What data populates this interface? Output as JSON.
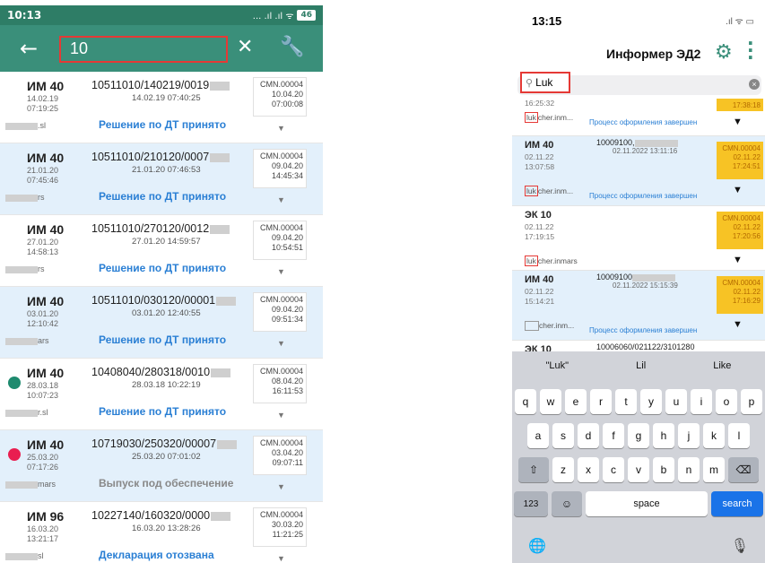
{
  "android": {
    "time": "10:13",
    "signal": "... .ıl .ıl ᯤ",
    "battery": "46",
    "back_icon": "arrow-left-icon",
    "search_value": "10",
    "close_icon": "close-icon",
    "wrench_icon": "wrench-icon",
    "rows": [
      {
        "type": "ИМ 40",
        "date1": "14.02.19",
        "time1": "07:19:25",
        "num": "10511010/140219/0019",
        "numdate": "14.02.19 07:40:25",
        "status": "Решение по ДТ принято",
        "user": ".sl",
        "cmn": "CMN.00004",
        "cdate": "10.04.20",
        "ctime": "07:00:08"
      },
      {
        "type": "ИМ 40",
        "date1": "21.01.20",
        "time1": "07:45:46",
        "num": "10511010/210120/0007",
        "numdate": "21.01.20 07:46:53",
        "status": "Решение по ДТ принято",
        "user": "rs",
        "cmn": "CMN.00004",
        "cdate": "09.04.20",
        "ctime": "14:45:34"
      },
      {
        "type": "ИМ 40",
        "date1": "27.01.20",
        "time1": "14:58:13",
        "num": "10511010/270120/0012",
        "numdate": "27.01.20 14:59:57",
        "status": "Решение по ДТ принято",
        "user": "rs",
        "cmn": "CMN.00004",
        "cdate": "09.04.20",
        "ctime": "10:54:51"
      },
      {
        "type": "ИМ 40",
        "date1": "03.01.20",
        "time1": "12:10:42",
        "num": "10511010/030120/00001",
        "numdate": "03.01.20 12:40:55",
        "status": "Решение по ДТ принято",
        "user": "ars",
        "cmn": "CMN.00004",
        "cdate": "09.04.20",
        "ctime": "09:51:34"
      },
      {
        "type": "ИМ 40",
        "date1": "28.03.18",
        "time1": "10:07:23",
        "num": "10408040/280318/0010",
        "numdate": "28.03.18 10:22:19",
        "status": "Решение по ДТ принято",
        "user": "r.sl",
        "cmn": "CMN.00004",
        "cdate": "08.04.20",
        "ctime": "16:11:53"
      },
      {
        "type": "ИМ 40",
        "date1": "25.03.20",
        "time1": "07:17:26",
        "num": "10719030/250320/00007",
        "numdate": "25.03.20 07:01:02",
        "status": "Выпуск под обеспечение",
        "user": "mars",
        "cmn": "CMN.00004",
        "cdate": "03.04.20",
        "ctime": "09:07:11"
      },
      {
        "type": "ИМ 96",
        "date1": "16.03.20",
        "time1": "13:21:17",
        "num": "10227140/160320/0000",
        "numdate": "16.03.20 13:28:26",
        "status": "Декларация отозвана",
        "user": "sl",
        "cmn": "CMN.00004",
        "cdate": "30.03.20",
        "ctime": "11:21:25"
      }
    ],
    "colors": {
      "toolbar": "#3a8f7a",
      "dot_green": "#1e8a6e",
      "dot_red": "#e91e50",
      "status_blue": "#2a7fd4"
    }
  },
  "ios": {
    "time": "13:15",
    "title": "Информер ЭД2",
    "search_value": "Luk",
    "gear_icon": "gear-icon",
    "menu_icon": "more-vertical-icon",
    "top_partial": {
      "date": "16:25:32",
      "user_luk": "luk",
      "user_rest": "cher.inm...",
      "proc": "Процесс оформления завершен",
      "ctime": "17:38:18"
    },
    "rows": [
      {
        "type": "ИМ 40",
        "date1": "02.11.22",
        "time1": "13:07:58",
        "num": "10009100,",
        "numdate": "02.11.2022 13:11:16",
        "luk": "luk",
        "user": "cher.inm...",
        "proc": "Процесс оформления завершен",
        "cmn": "CMN.00004",
        "cdate": "02.11.22",
        "ctime": "17:24:51"
      },
      {
        "type": "ЭК 10",
        "date1": "02.11.22",
        "time1": "17:19:15",
        "num": "",
        "numdate": "",
        "luk": "luk",
        "user": "cher.inmars",
        "proc": "",
        "cmn": "CMN.00004",
        "cdate": "02.11.22",
        "ctime": "17:20:56"
      },
      {
        "type": "ИМ 40",
        "date1": "02.11.22",
        "time1": "15:14:21",
        "num": "10009100",
        "numdate": "02.11.2022 15:15:39",
        "luk": "",
        "user": "cher.inm...",
        "proc": "Процесс оформления завершен",
        "cmn": "CMN.00004",
        "cdate": "02.11.22",
        "ctime": "17:16:29"
      },
      {
        "type": "ЭК 10",
        "date1": "",
        "time1": "",
        "num": "10006060/021122/3101280",
        "numdate": "",
        "luk": "",
        "user": "",
        "proc": "",
        "cmn": "",
        "cdate": "",
        "ctime": ""
      }
    ],
    "keyboard": {
      "suggestions": [
        "\"Luk\"",
        "Lil",
        "Like"
      ],
      "row1": [
        "q",
        "w",
        "e",
        "r",
        "t",
        "y",
        "u",
        "i",
        "o",
        "p"
      ],
      "row2": [
        "a",
        "s",
        "d",
        "f",
        "g",
        "h",
        "j",
        "k",
        "l"
      ],
      "row3": [
        "z",
        "x",
        "c",
        "v",
        "b",
        "n",
        "m"
      ],
      "num_key": "123",
      "space": "space",
      "search": "search"
    }
  }
}
